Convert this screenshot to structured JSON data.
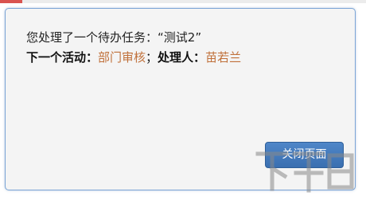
{
  "dialog": {
    "message_prefix": "您处理了一个待办任务：",
    "task_name": "“测试2”",
    "activity_label": "下一个活动：",
    "activity_value": "部门审核",
    "separator": "；",
    "handler_label": "处理人：",
    "handler_value": "苗若兰",
    "close_button_label": "关闭页面"
  },
  "colors": {
    "dialog_border": "#7aa4d6",
    "dialog_background": "#f4f4f4",
    "highlight_value": "#c0703a",
    "button_background": "#3f78bc"
  }
}
